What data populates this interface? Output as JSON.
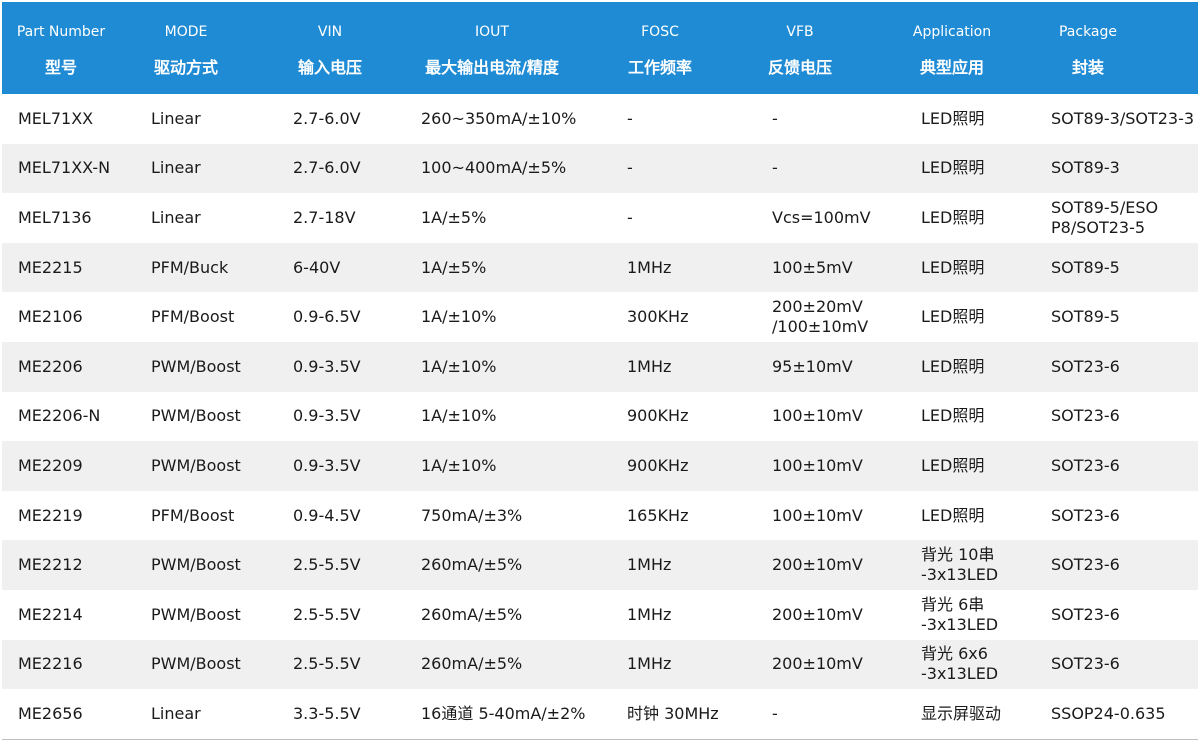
{
  "header": [
    {
      "en": "Part Number",
      "zh": "型号"
    },
    {
      "en": "MODE",
      "zh": "驱动方式"
    },
    {
      "en": "VIN",
      "zh": "输入电压"
    },
    {
      "en": "IOUT",
      "zh": "最大输出电流/精度"
    },
    {
      "en": "FOSC",
      "zh": "工作频率"
    },
    {
      "en": "VFB",
      "zh": "反馈电压"
    },
    {
      "en": "Application",
      "zh": "典型应用"
    },
    {
      "en": "Package",
      "zh": "封装"
    }
  ],
  "rows": [
    {
      "part": "MEL71XX",
      "mode": "Linear",
      "vin": "2.7-6.0V",
      "iout": "260~350mA/±10%",
      "fosc": "-",
      "vfb": "-",
      "app": "LED照明",
      "pkg": "SOT89-3/SOT23-3"
    },
    {
      "part": "MEL71XX-N",
      "mode": "Linear",
      "vin": "2.7-6.0V",
      "iout": "100~400mA/±5%",
      "fosc": "-",
      "vfb": "-",
      "app": "LED照明",
      "pkg": "SOT89-3"
    },
    {
      "part": "MEL7136",
      "mode": "Linear",
      "vin": "2.7-18V",
      "iout": "1A/±5%",
      "fosc": "-",
      "vfb": "Vcs=100mV",
      "app": "LED照明",
      "pkg": "SOT89-5/ESO\nP8/SOT23-5"
    },
    {
      "part": "ME2215",
      "mode": "PFM/Buck",
      "vin": "6-40V",
      "iout": "1A/±5%",
      "fosc": "1MHz",
      "vfb": "100±5mV",
      "app": "LED照明",
      "pkg": "SOT89-5"
    },
    {
      "part": "ME2106",
      "mode": "PFM/Boost",
      "vin": "0.9-6.5V",
      "iout": "1A/±10%",
      "fosc": "300KHz",
      "vfb": "200±20mV\n/100±10mV",
      "app": "LED照明",
      "pkg": "SOT89-5"
    },
    {
      "part": "ME2206",
      "mode": "PWM/Boost",
      "vin": "0.9-3.5V",
      "iout": "1A/±10%",
      "fosc": "1MHz",
      "vfb": "95±10mV",
      "app": "LED照明",
      "pkg": "SOT23-6"
    },
    {
      "part": "ME2206-N",
      "mode": "PWM/Boost",
      "vin": "0.9-3.5V",
      "iout": "1A/±10%",
      "fosc": "900KHz",
      "vfb": "100±10mV",
      "app": "LED照明",
      "pkg": "SOT23-6"
    },
    {
      "part": "ME2209",
      "mode": "PWM/Boost",
      "vin": "0.9-3.5V",
      "iout": "1A/±10%",
      "fosc": "900KHz",
      "vfb": "100±10mV",
      "app": "LED照明",
      "pkg": "SOT23-6"
    },
    {
      "part": "ME2219",
      "mode": "PFM/Boost",
      "vin": "0.9-4.5V",
      "iout": "750mA/±3%",
      "fosc": "165KHz",
      "vfb": "100±10mV",
      "app": "LED照明",
      "pkg": "SOT23-6"
    },
    {
      "part": "ME2212",
      "mode": "PWM/Boost",
      "vin": "2.5-5.5V",
      "iout": "260mA/±5%",
      "fosc": "1MHz",
      "vfb": "200±10mV",
      "app": "背光 10串\n-3x13LED",
      "pkg": "SOT23-6"
    },
    {
      "part": "ME2214",
      "mode": "PWM/Boost",
      "vin": "2.5-5.5V",
      "iout": "260mA/±5%",
      "fosc": "1MHz",
      "vfb": "200±10mV",
      "app": "背光 6串\n-3x13LED",
      "pkg": "SOT23-6"
    },
    {
      "part": "ME2216",
      "mode": "PWM/Boost",
      "vin": "2.5-5.5V",
      "iout": "260mA/±5%",
      "fosc": "1MHz",
      "vfb": "200±10mV",
      "app": "背光 6x6\n-3x13LED",
      "pkg": "SOT23-6"
    },
    {
      "part": "ME2656",
      "mode": "Linear",
      "vin": "3.3-5.5V",
      "iout": "16通道 5-40mA/±2%",
      "fosc": "时钟 30MHz",
      "vfb": "-",
      "app": "显示屏驱动",
      "pkg": "SSOP24-0.635"
    }
  ]
}
